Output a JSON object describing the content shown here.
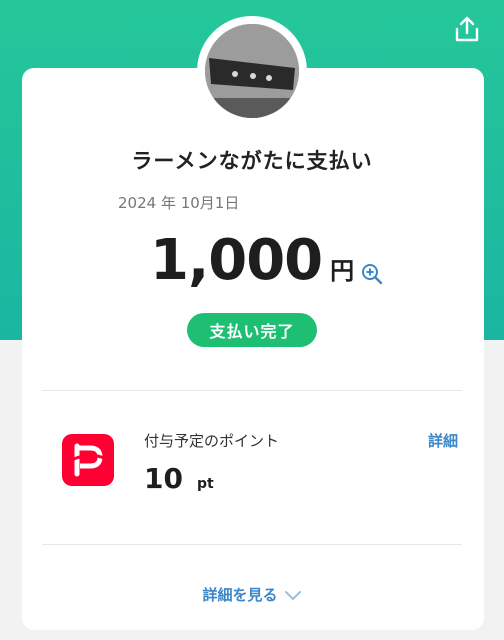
{
  "merchant": {
    "name": "ラーメンながたに支払い"
  },
  "payment": {
    "date": "2024 年 10月1日",
    "amount": "1,000",
    "currency": "円",
    "status": "支払い完了"
  },
  "points": {
    "label": "付与予定のポイント",
    "value": "10",
    "unit": "pt",
    "details_link": "詳細"
  },
  "footer": {
    "see_details": "詳細を見る"
  },
  "icons": {
    "share": "share-icon",
    "zoom": "zoom-in-icon",
    "paypay": "paypay-logo-icon",
    "chevron": "chevron-down-icon"
  },
  "colors": {
    "header_green": "#25c79a",
    "status_green": "#1fbf73",
    "link_blue": "#3b87c9",
    "paypay_red": "#ff0033"
  }
}
